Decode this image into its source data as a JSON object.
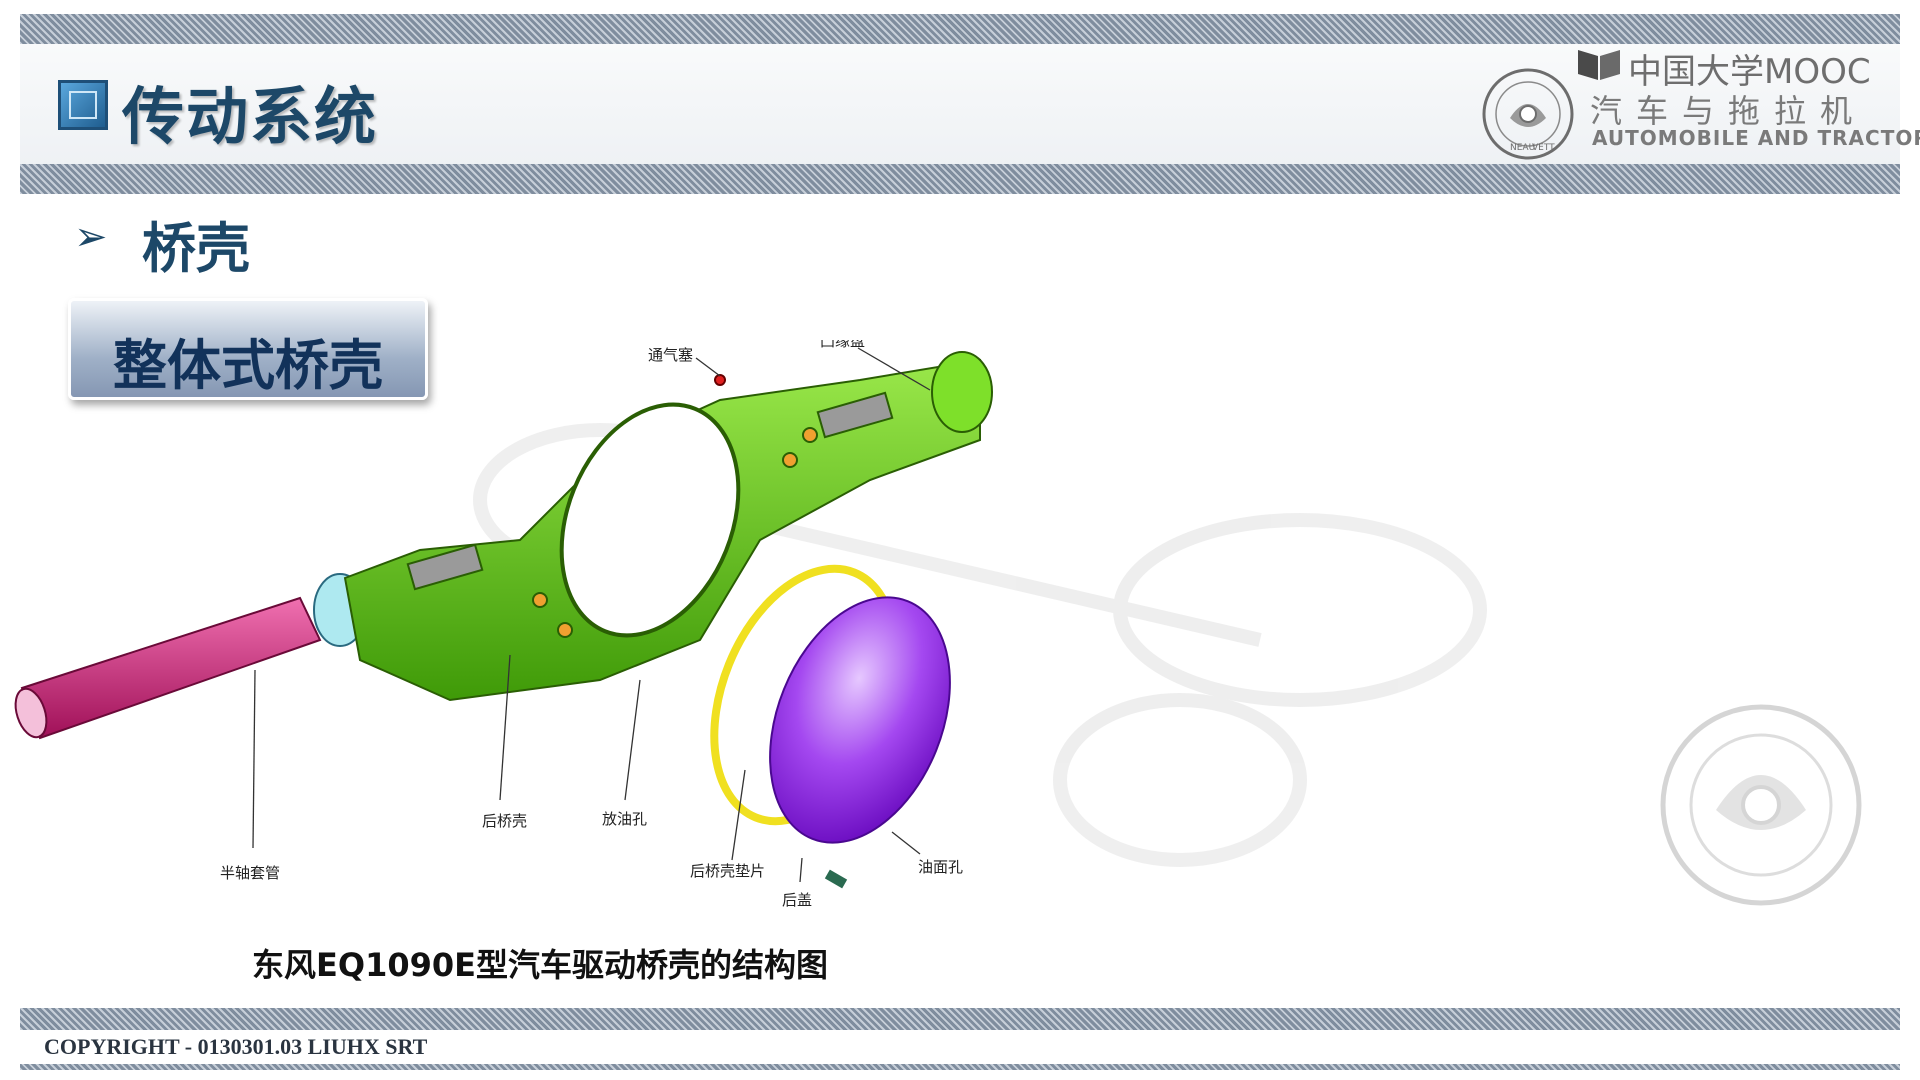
{
  "header": {
    "title": "传动系统",
    "brand": "中国大学MOOC",
    "course_cn": "汽车与拖拉机",
    "course_en": "AUTOMOBILE AND TRACTOR",
    "seal_text": [
      "NEAU",
      "VETT"
    ]
  },
  "section": {
    "title": "桥壳",
    "subtype": "整体式桥壳"
  },
  "figure": {
    "labels": {
      "vent_plug": "通气塞",
      "flange": "凸缘盘",
      "rear_housing": "后桥壳",
      "drain_hole": "放油孔",
      "axle_tube": "半轴套管",
      "housing_gasket": "后桥壳垫片",
      "rear_cover": "后盖",
      "oil_level_hole": "油面孔"
    },
    "caption": "东风EQ1090E型汽车驱动桥壳的结构图"
  },
  "footer": {
    "copyright": "COPYRIGHT - 0130301.03 LIUHX SRT"
  },
  "colors": {
    "title_blue": "#1d4868",
    "housing_green": "#6ccf14",
    "cover_purple": "#8a1fd8",
    "tube_pink": "#c8206e",
    "gasket_yellow": "#f0e020"
  }
}
